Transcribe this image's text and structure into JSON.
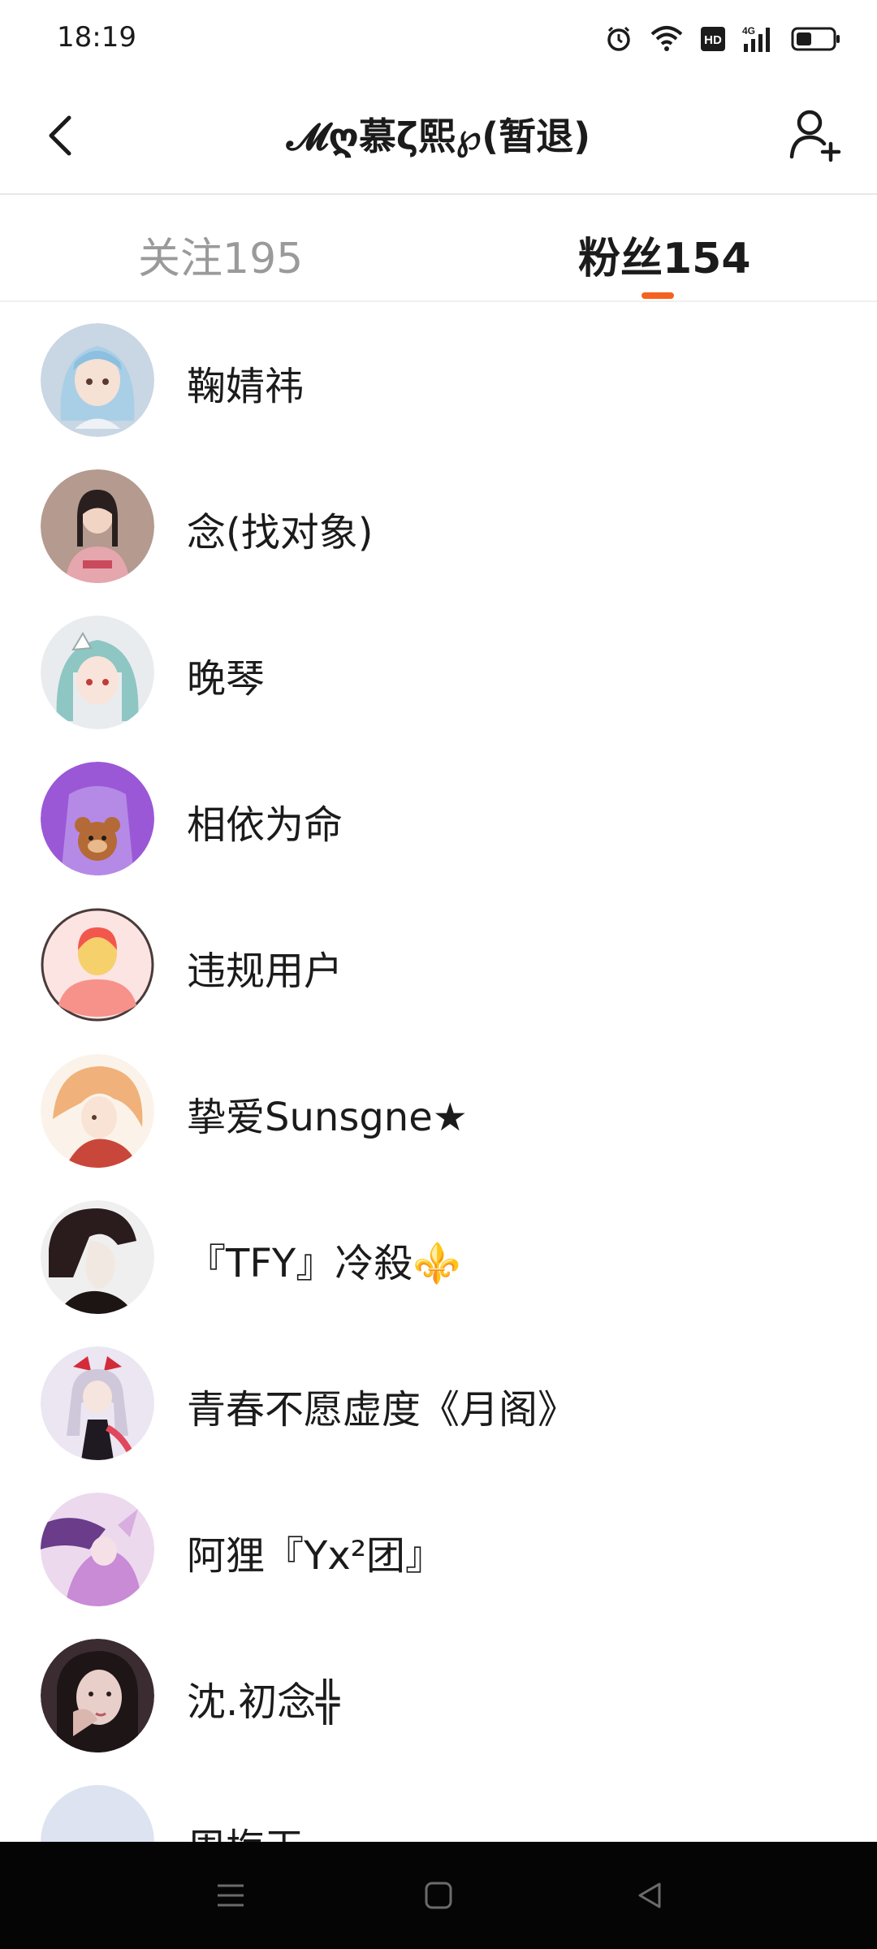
{
  "status_bar": {
    "time": "18:19",
    "icons": [
      "alarm-icon",
      "wifi-icon",
      "hd-icon",
      "signal-4g-icon",
      "battery-icon"
    ],
    "hd_label": "HD",
    "network_label": "4G"
  },
  "header": {
    "title": "𝓜ღ慕ζ熙℘(暂退)",
    "back_icon": "chevron-left-icon",
    "add_icon": "add-user-icon"
  },
  "tabs": {
    "following_label": "关注195",
    "followers_label": "粉丝154",
    "active": "followers",
    "accent_color": "#f4621f"
  },
  "followers": [
    {
      "name": "鞠婧祎",
      "avatar": "anime-blue-hair-avatar",
      "color": "#a9cfe6"
    },
    {
      "name": "念(找对象)",
      "avatar": "photo-girl-pink-shirt-avatar",
      "color": "#e6a6ae"
    },
    {
      "name": "晚琴",
      "avatar": "anime-teal-hair-avatar",
      "color": "#8ec6c3"
    },
    {
      "name": "相依为命",
      "avatar": "purple-bear-avatar",
      "color": "#9b58d6"
    },
    {
      "name": "违规用户",
      "avatar": "default-user-avatar",
      "color": "#f3c8c5"
    },
    {
      "name": "挚爱Sunsgne★",
      "avatar": "anime-orange-hair-avatar",
      "color": "#f0b27a"
    },
    {
      "name": "『TFY』冷殺⚜️",
      "avatar": "dark-silhouette-avatar",
      "color": "#3a2a2a"
    },
    {
      "name": "青春不愿虚度《月阁》",
      "avatar": "anime-red-bow-avatar",
      "color": "#d9d0e6"
    },
    {
      "name": "阿狸『Yx²团』",
      "avatar": "anime-purple-fantasy-avatar",
      "color": "#c98ad6"
    },
    {
      "name": "沈.初念╬",
      "avatar": "photo-girl-dark-avatar",
      "color": "#3b2c31"
    },
    {
      "name": "周梅玉",
      "avatar": "partial-avatar",
      "color": "#dde3f0"
    }
  ],
  "nav_bar": {
    "icons": [
      "menu-icon",
      "home-square-icon",
      "back-triangle-icon"
    ]
  }
}
